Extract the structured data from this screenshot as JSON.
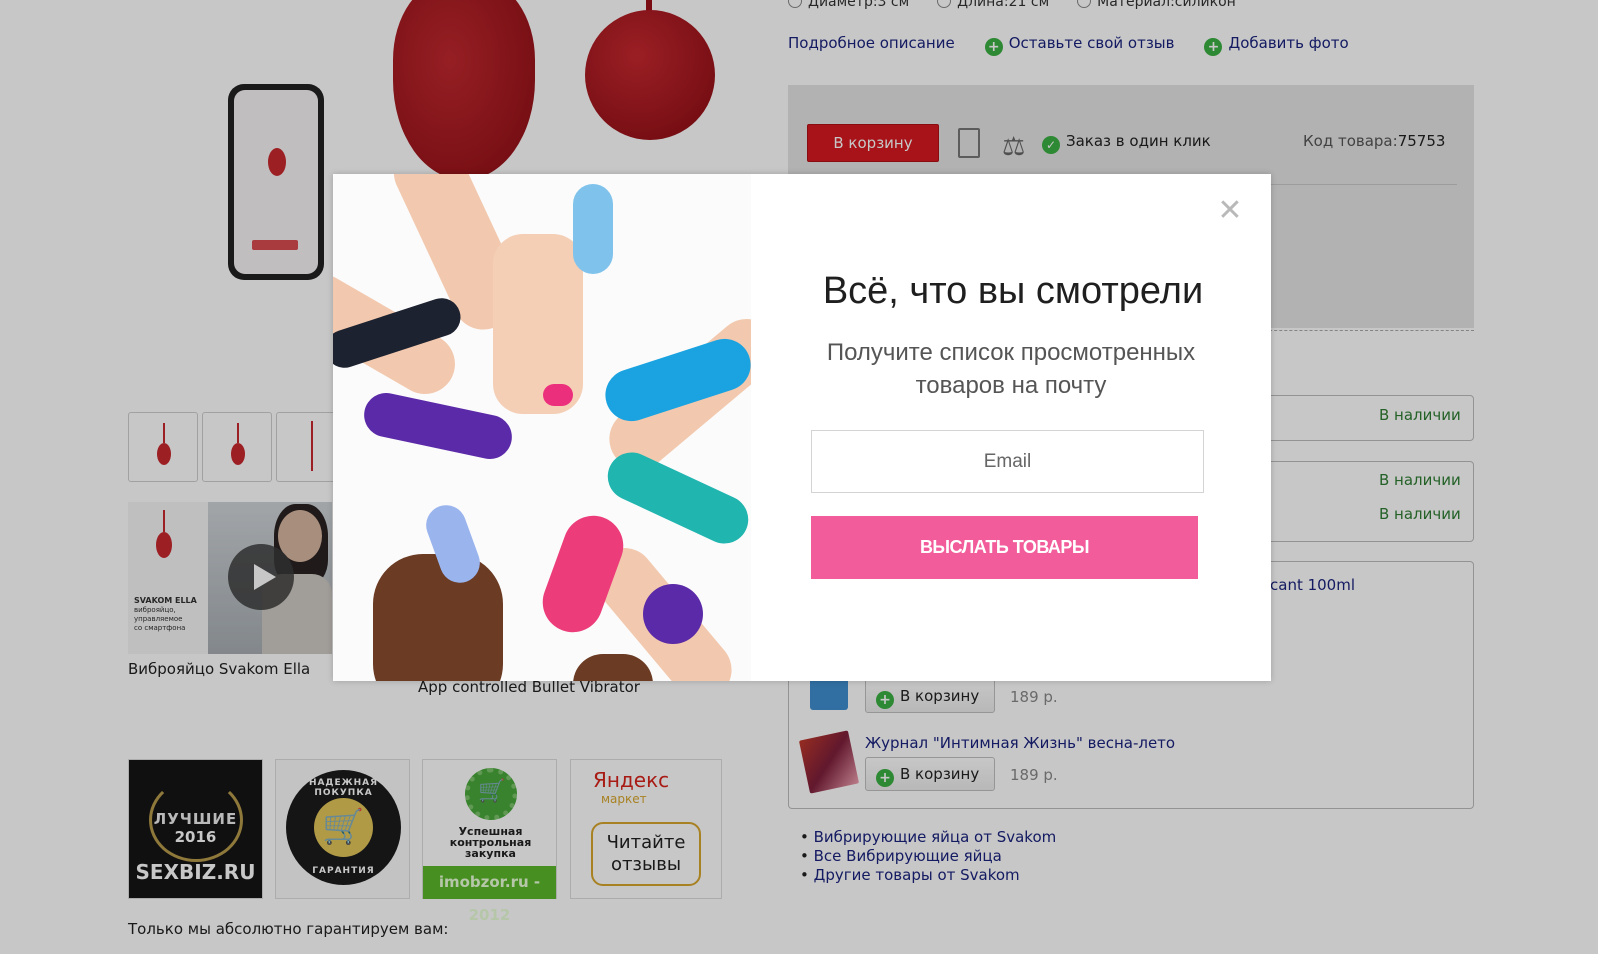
{
  "specs": [
    "Диаметр:3 см",
    "Длина:21 см",
    "Материал:силикон"
  ],
  "actions": {
    "description": "Подробное описание",
    "review": "Оставьте свой отзыв",
    "add_photo": "Добавить фото"
  },
  "buybox": {
    "cart_label": "В корзину",
    "one_click": "Заказ в один клик",
    "code_label": "Код товара:",
    "code_value": "75753"
  },
  "stock": [
    "В наличии",
    "В наличии",
    "В наличии"
  ],
  "accessories": {
    "cut_title": "cant 100ml",
    "items": [
      {
        "cart_label": "В корзину",
        "price": "189 р."
      },
      {
        "title": "Журнал \"Интимная Жизнь\" весна-лето",
        "cart_label": "В корзину",
        "price": "189 р."
      }
    ]
  },
  "related_links": [
    "Вибрирующие яйца от Svakom",
    "Все Вибрирующие яйца",
    "Другие товары от Svakom"
  ],
  "video": {
    "caption": "Виброяйцо Svakom Ella",
    "overlay_title": "SVAKOM ELLA",
    "overlay_lines": [
      "виброяйцо,",
      "управляемое",
      "со смартфона"
    ]
  },
  "caption2": "App controlled Bullet Vibrator",
  "badges": {
    "b1": {
      "line1": "ЛУЧШИЕ",
      "line2": "2016",
      "line3": "SEXBIZ.RU"
    },
    "b2": {
      "top": "НАДЕЖНАЯ ПОКУПКА",
      "bottom": "ГАРАНТИЯ"
    },
    "b3": {
      "text": "Успешная контрольная закупка",
      "bar": "imobzor.ru - 2012"
    },
    "b4": {
      "brand": "Яндекс",
      "sub": "маркет",
      "bubble": "Читайте отзывы"
    }
  },
  "footer_text": "Только мы абсолютно гарантируем вам:",
  "modal": {
    "title": "Всё, что вы смотрели",
    "subtitle": "Получите список просмотренных товаров на почту",
    "email_placeholder": "Email",
    "submit_label": "ВЫСЛАТЬ ТОВАРЫ",
    "close_icon": "close-icon"
  },
  "colors": {
    "cart_red": "#d7191f",
    "accent_pink": "#f25c9b",
    "green": "#3cb043",
    "link_blue": "#1a237e"
  }
}
